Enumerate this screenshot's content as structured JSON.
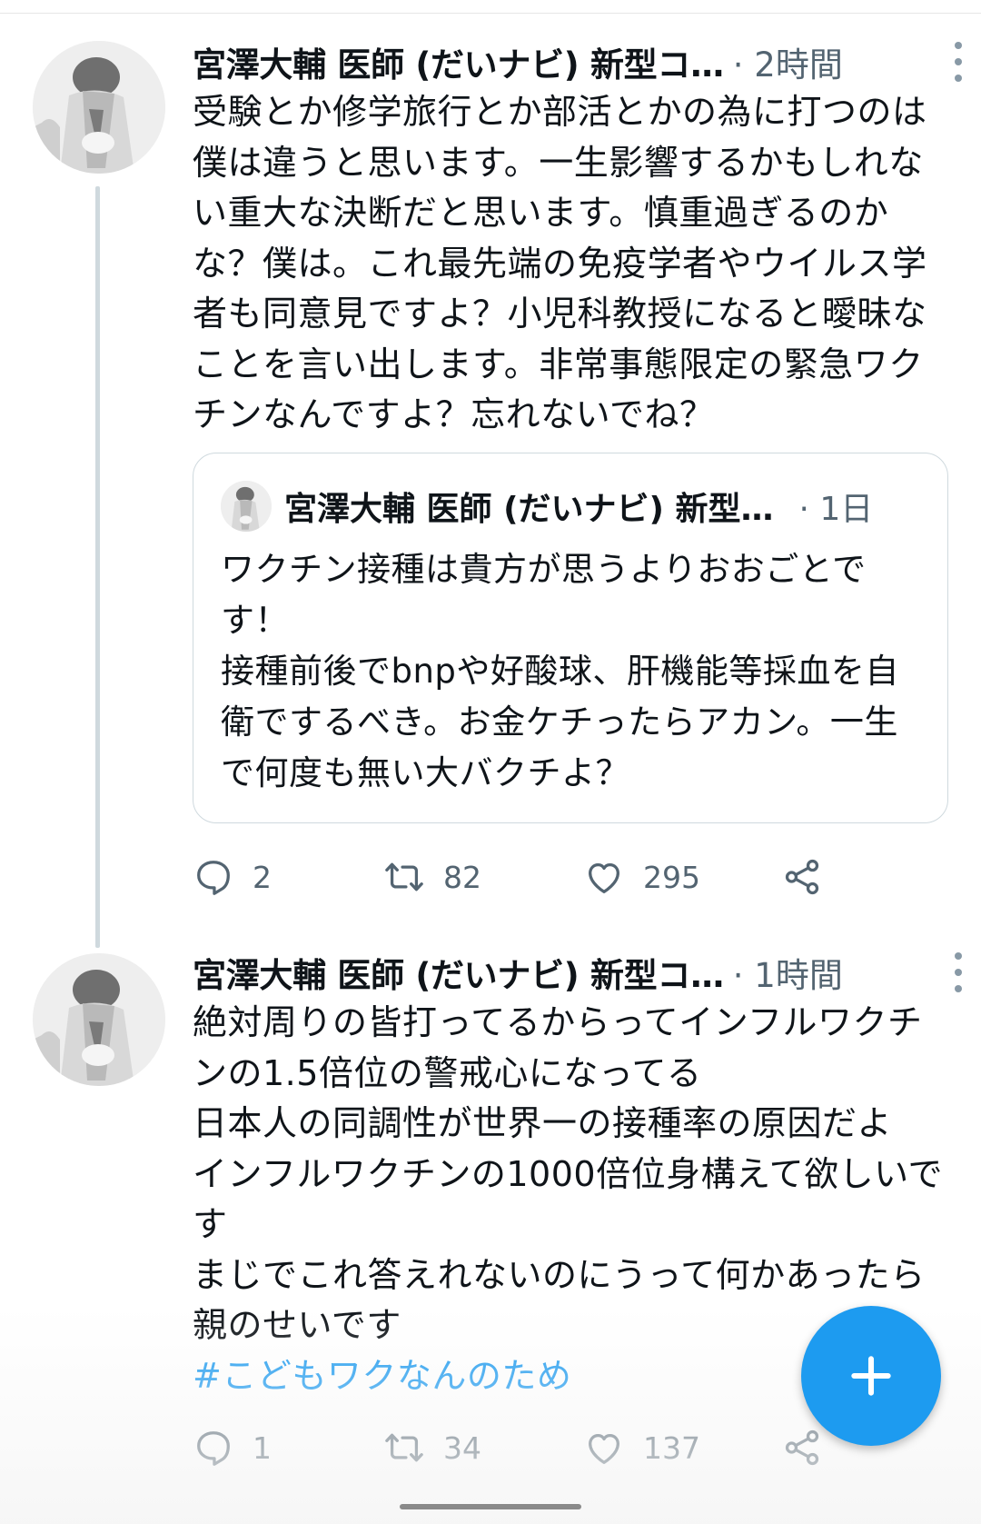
{
  "tweets": [
    {
      "author": "宮澤大輔 医師 (だいナビ) 新型コ…",
      "time": "· 2時間",
      "text": "受験とか修学旅行とか部活とかの為に打つのは僕は違うと思います。一生影響するかもしれない重大な決断だと思います。慎重過ぎるのかな？僕は。これ最先端の免疫学者やウイルス学者も同意見ですよ？小児科教授になると曖昧なことを言い出します。非常事態限定の緊急ワクチンなんですよ？忘れないでね？",
      "quote": {
        "author": "宮澤大輔 医師 (だいナビ) 新型…",
        "time": "· 1日",
        "text": "ワクチン接種は貴方が思うよりおおごとです！\n接種前後でbnpや好酸球、肝機能等採血を自衛でするべき。お金ケチったらアカン。一生で何度も無い大バクチよ？"
      },
      "replies": "2",
      "retweets": "82",
      "likes": "295"
    },
    {
      "author": "宮澤大輔 医師 (だいナビ) 新型コ…",
      "time": "· 1時間",
      "text": "絶対周りの皆打ってるからってインフルワクチンの1.5倍位の警戒心になってる\n日本人の同調性が世界一の接種率の原因だよ\nインフルワクチンの1000倍位身構えて欲しいです\nまじでこれ答えれないのにうって何かあったら親のせいです",
      "hashtag": "#こどもワクなんのため",
      "replies": "1",
      "retweets": "34",
      "likes": "137"
    }
  ],
  "icons": [
    "reply-icon",
    "retweet-icon",
    "like-icon",
    "share-icon",
    "more-icon",
    "compose-icon"
  ],
  "colors": {
    "accent": "#1d9bf0",
    "muted": "#536471",
    "thread_line": "#cfd9de"
  }
}
